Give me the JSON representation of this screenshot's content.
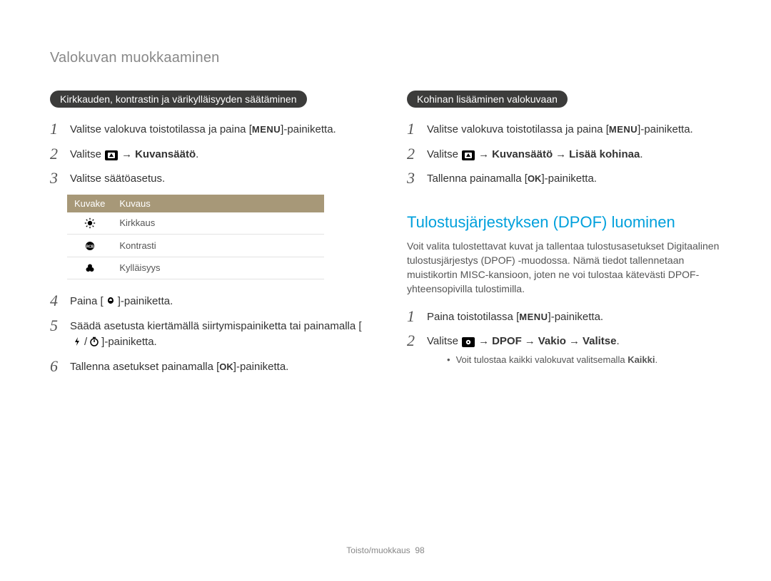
{
  "page_title": "Valokuvan muokkaaminen",
  "left": {
    "pill": "Kirkkauden, kontrastin ja värikylläisyyden säätäminen",
    "steps": {
      "s1_pre": "Valitse valokuva toistotilassa ja paina [",
      "s1_menu": "MENU",
      "s1_post": "]-painiketta.",
      "s2_pre": "Valitse ",
      "s2_arrow": " → ",
      "s2_bold": "Kuvansäätö",
      "s2_dot": ".",
      "s3": "Valitse säätöasetus.",
      "s4_pre": "Paina [",
      "s4_post": "]-painiketta.",
      "s5_a": "Säädä asetusta kiertämällä siirtymispainiketta tai painamalla [",
      "s5_slash": "/",
      "s5_b": "]-painiketta.",
      "s6_pre": "Tallenna asetukset painamalla [",
      "s6_ok": "OK",
      "s6_post": "]-painiketta."
    },
    "table": {
      "h1": "Kuvake",
      "h2": "Kuvaus",
      "rows": [
        {
          "label": "Kirkkaus",
          "icon": "brightness"
        },
        {
          "label": "Kontrasti",
          "icon": "contrast"
        },
        {
          "label": "Kylläisyys",
          "icon": "saturation"
        }
      ]
    }
  },
  "right": {
    "pill": "Kohinan lisääminen valokuvaan",
    "steps": {
      "s1_pre": "Valitse valokuva toistotilassa ja paina [",
      "s1_menu": "MENU",
      "s1_post": "]-painiketta.",
      "s2_pre": "Valitse ",
      "s2_arrow": " → ",
      "s2_bold1": "Kuvansäätö",
      "s2_bold2": "Lisää kohinaa",
      "s2_dot": ".",
      "s3_pre": "Tallenna painamalla [",
      "s3_ok": "OK",
      "s3_post": "]-painiketta."
    },
    "section_title": "Tulostusjärjestyksen (DPOF) luominen",
    "section_para": "Voit valita tulostettavat kuvat ja tallentaa tulostusasetukset Digitaalinen tulostusjärjestys (DPOF) -muodossa. Nämä tiedot tallennetaan muistikortin MISC-kansioon, joten ne voi tulostaa kätevästi DPOF-yhteensopivilla tulostimilla.",
    "steps2": {
      "s1_pre": "Paina toistotilassa [",
      "s1_menu": "MENU",
      "s1_post": "]-painiketta.",
      "s2_pre": "Valitse ",
      "s2_arrow": " → ",
      "s2_b1": "DPOF",
      "s2_b2": "Vakio",
      "s2_b3": "Valitse",
      "s2_dot": ".",
      "bullet_pre": "Voit tulostaa kaikki valokuvat valitsemalla ",
      "bullet_bold": "Kaikki",
      "bullet_dot": "."
    }
  },
  "footer_label": "Toisto/muokkaus",
  "footer_page": "98"
}
